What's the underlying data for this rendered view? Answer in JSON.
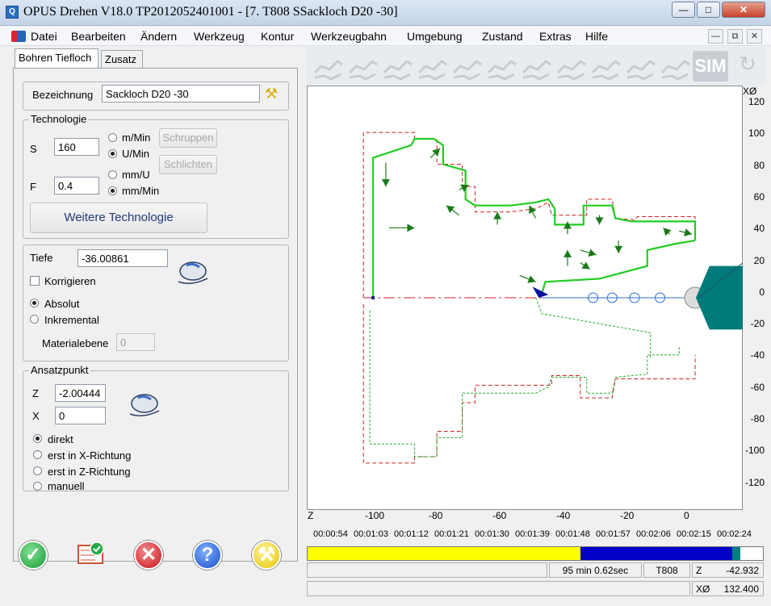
{
  "window": {
    "title": "OPUS Drehen V18.0   TP2012052401001     - [7. T808 SSackloch D20 -30]",
    "app_icon": "Q"
  },
  "menu": [
    "Datei",
    "Bearbeiten",
    "Ändern",
    "Werkzeug",
    "Kontur",
    "Werkzeugbahn",
    "Umgebung",
    "Zustand",
    "Extras",
    "Hilfe"
  ],
  "tabs": [
    "Bohren Tiefloch",
    "Zusatz"
  ],
  "form": {
    "bezeichnung_label": "Bezeichnung",
    "bezeichnung_value": "Sackloch D20 -30",
    "technologie_label": "Technologie",
    "s_label": "S",
    "s_value": "160",
    "s_unit1": "m/Min",
    "s_unit2": "U/Min",
    "f_label": "F",
    "f_value": "0.4",
    "f_unit1": "mm/U",
    "f_unit2": "mm/Min",
    "schruppen": "Schruppen",
    "schlichten": "Schlichten",
    "weitere": "Weitere Technologie",
    "tiefe_label": "Tiefe",
    "tiefe_value": "-36.00861",
    "korrigieren": "Korrigieren",
    "absolut": "Absolut",
    "inkremental": "Inkremental",
    "materialebene_label": "Materialebene",
    "materialebene_value": "0",
    "ansatzpunkt_label": "Ansatzpunkt",
    "z_label": "Z",
    "z_value": "-2.00444",
    "x_label": "X",
    "x_value": "0",
    "direkt": "direkt",
    "erst_x": "erst in X-Richtung",
    "erst_z": "erst in Z-Richtung",
    "manuell": "manuell"
  },
  "toolbar": {
    "sim": "SIM"
  },
  "axes": {
    "x_ticks": [
      "-100",
      "-80",
      "-60",
      "-40",
      "-20",
      "0"
    ],
    "y_ticks": [
      "120",
      "100",
      "80",
      "60",
      "40",
      "20",
      "0",
      "-20",
      "-40",
      "-60",
      "-80",
      "-100",
      "-120"
    ],
    "x_axis": "Z",
    "y_axis": "XØ"
  },
  "timeline": [
    "00:00:54",
    "00:01:03",
    "00:01:12",
    "00:01:21",
    "00:01:30",
    "00:01:39",
    "00:01:48",
    "00:01:57",
    "00:02:06",
    "00:02:15",
    "00:02:24"
  ],
  "progress": {
    "yellow_fraction": 0.6,
    "blue_fraction": 0.34
  },
  "status": {
    "time": "95 min 0.62sec",
    "tool": "T808",
    "z_label": "Z",
    "z_value": "-42.932",
    "x_label": "XØ",
    "x_value": "132.400"
  }
}
